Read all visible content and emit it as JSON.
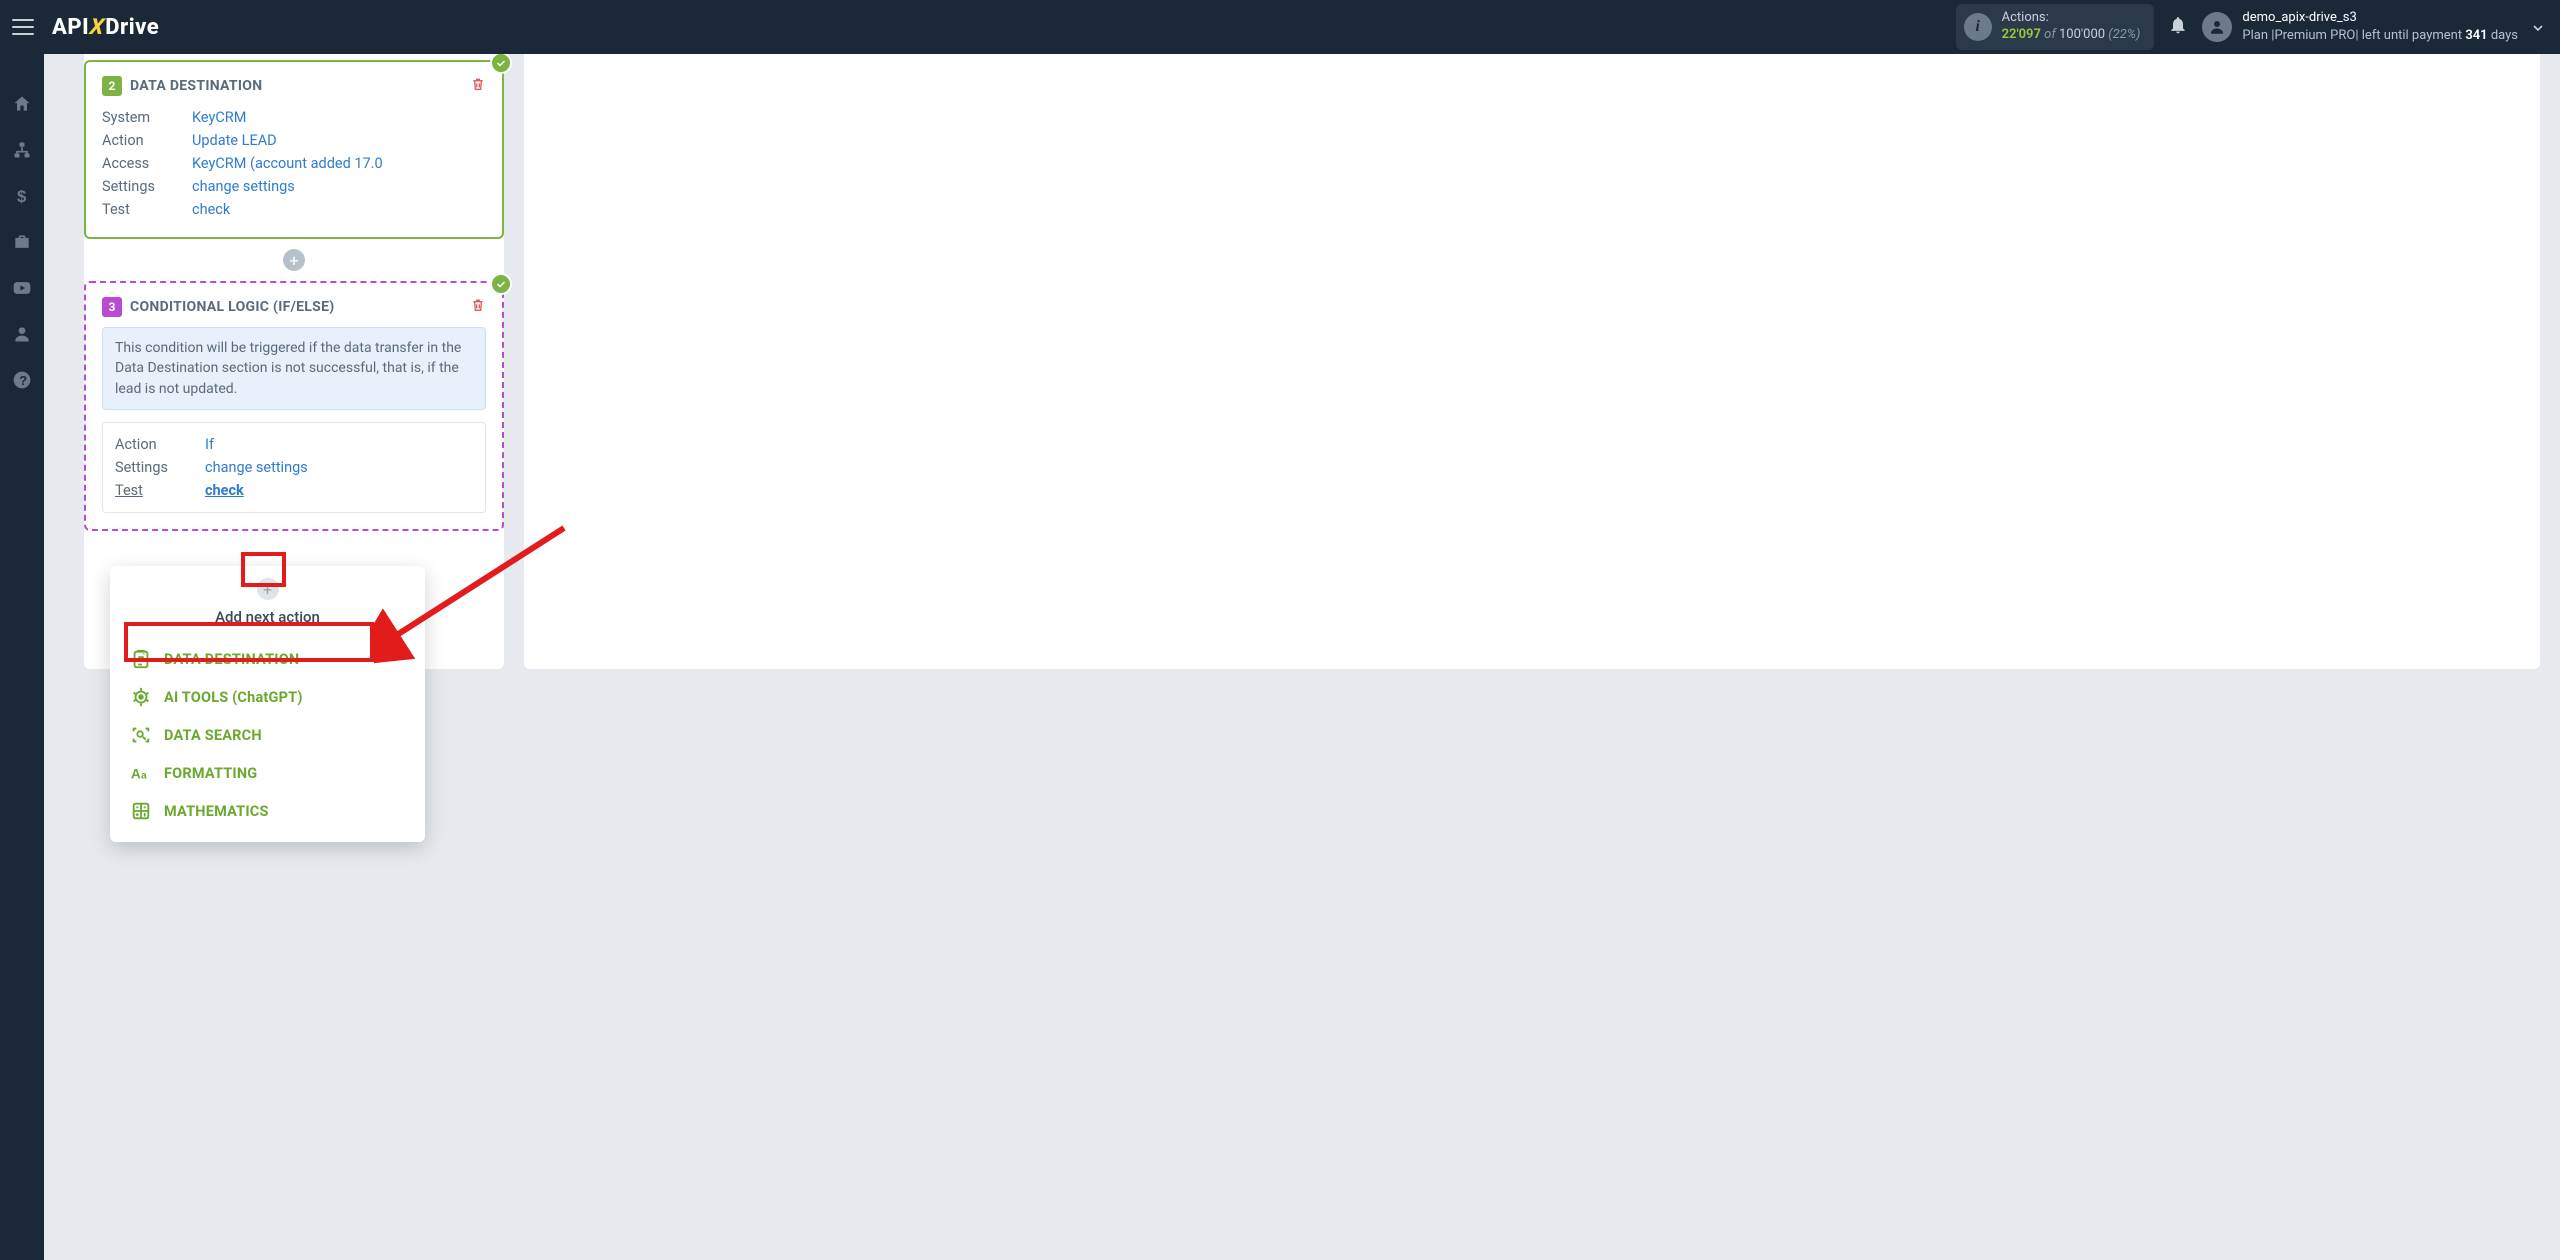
{
  "header": {
    "logo": {
      "api": "API",
      "x": "X",
      "drive": "Drive"
    },
    "actions": {
      "label": "Actions:",
      "used": "22'097",
      "of": "of",
      "total": "100'000",
      "pct": "(22%)"
    },
    "user": {
      "name": "demo_apix-drive_s3",
      "plan_prefix": "Plan |",
      "plan_name": "Premium PRO",
      "plan_mid": "| left until payment ",
      "plan_days_num": "341",
      "plan_days_word": " days"
    }
  },
  "step2": {
    "num": "2",
    "title": "DATA DESTINATION",
    "rows": {
      "system_k": "System",
      "system_v": "KeyCRM",
      "action_k": "Action",
      "action_v": "Update LEAD",
      "access_k": "Access",
      "access_v": "KeyCRM (account added 17.0",
      "settings_k": "Settings",
      "settings_v": "change settings",
      "test_k": "Test",
      "test_v": "check"
    }
  },
  "step3": {
    "num": "3",
    "title": "CONDITIONAL LOGIC (IF/ELSE)",
    "info": "This condition will be triggered if the data transfer in the Data Destination section is not successful, that is, if the lead is not updated.",
    "rows": {
      "action_k": "Action",
      "action_v": "If",
      "settings_k": "Settings",
      "settings_v": "change settings",
      "test_k": "Test",
      "test_v": "check"
    }
  },
  "popup": {
    "title": "Add next action",
    "items": {
      "datadest": "DATA DESTINATION",
      "aitools": "AI TOOLS (ChatGPT)",
      "datasearch": "DATA SEARCH",
      "formatting": "FORMATTING",
      "math": "MATHEMATICS"
    }
  }
}
